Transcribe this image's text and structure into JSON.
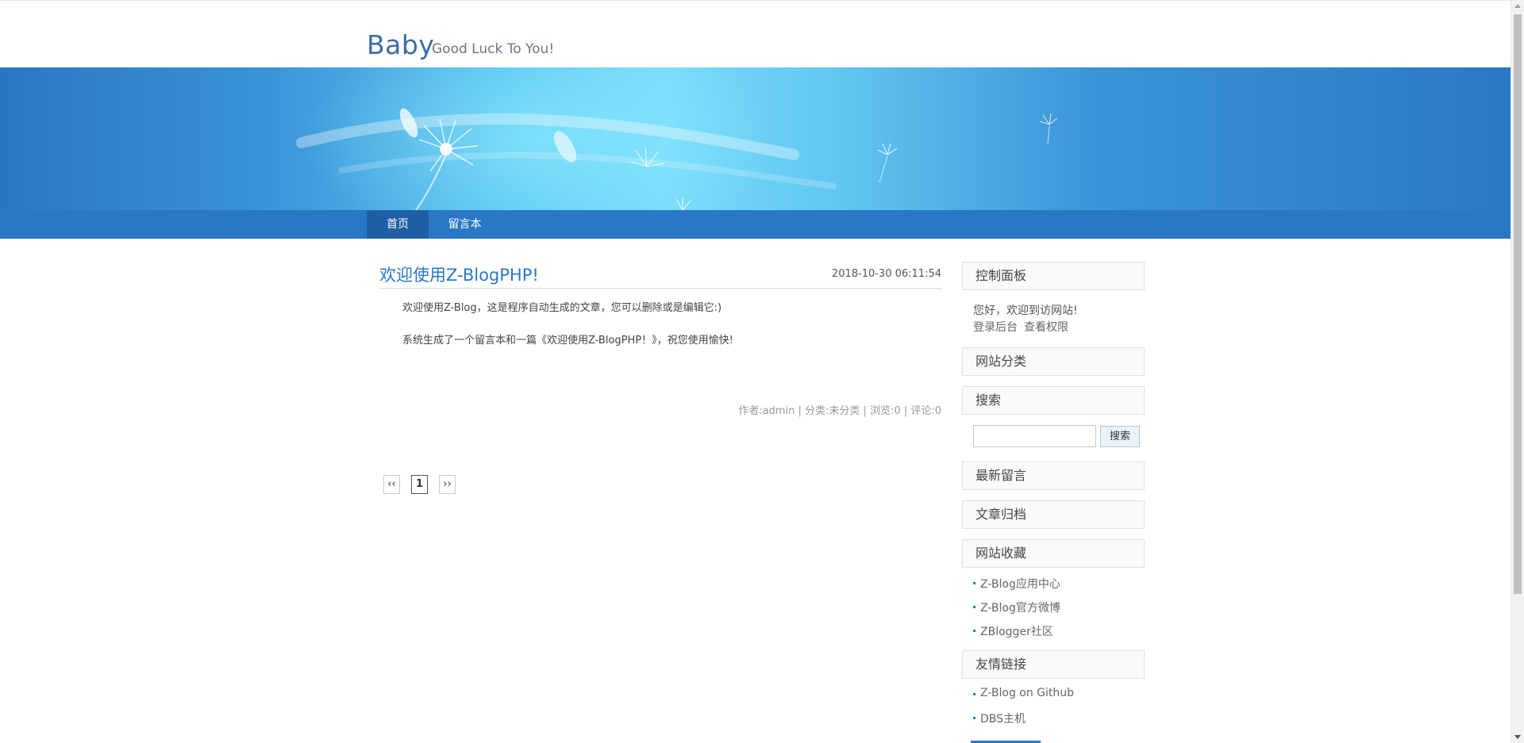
{
  "header": {
    "site_title": "Baby",
    "site_subtitle": "Good Luck To You!"
  },
  "nav": {
    "items": [
      {
        "label": "首页",
        "active": true
      },
      {
        "label": "留言本",
        "active": false
      }
    ]
  },
  "post": {
    "title": "欢迎使用Z-BlogPHP!",
    "date": "2018-10-30 06:11:54",
    "paragraphs": [
      "欢迎使用Z-Blog，这是程序自动生成的文章，您可以删除或是编辑它:)",
      "系统生成了一个留言本和一篇《欢迎使用Z-BlogPHP！》，祝您使用愉快!"
    ],
    "meta": {
      "author": "作者:admin",
      "sep1": " | ",
      "category": "分类:未分类",
      "sep2": " | ",
      "views": "浏览:0",
      "sep3": " | ",
      "comments": "评论:0"
    }
  },
  "pager": {
    "prev": "‹‹",
    "current": "1",
    "next": "››"
  },
  "sidebar": {
    "control_panel": {
      "title": "控制面板",
      "welcome": "您好，欢迎到访网站!",
      "login": "登录后台",
      "permissions": "查看权限"
    },
    "categories": {
      "title": "网站分类"
    },
    "search": {
      "title": "搜索",
      "button": "搜索",
      "value": ""
    },
    "latest_comments": {
      "title": "最新留言"
    },
    "archives": {
      "title": "文章归档"
    },
    "favorites": {
      "title": "网站收藏",
      "links": [
        "Z-Blog应用中心",
        "Z-Blog官方微博",
        "ZBlogger社区"
      ]
    },
    "friend_links": {
      "title": "友情链接",
      "links": [
        "Z-Blog on Github",
        "DBS主机"
      ]
    }
  },
  "colors": {
    "accent": "#2a78c5",
    "nav_active": "#1f5fa6",
    "title_blue": "#3a6ea5"
  }
}
